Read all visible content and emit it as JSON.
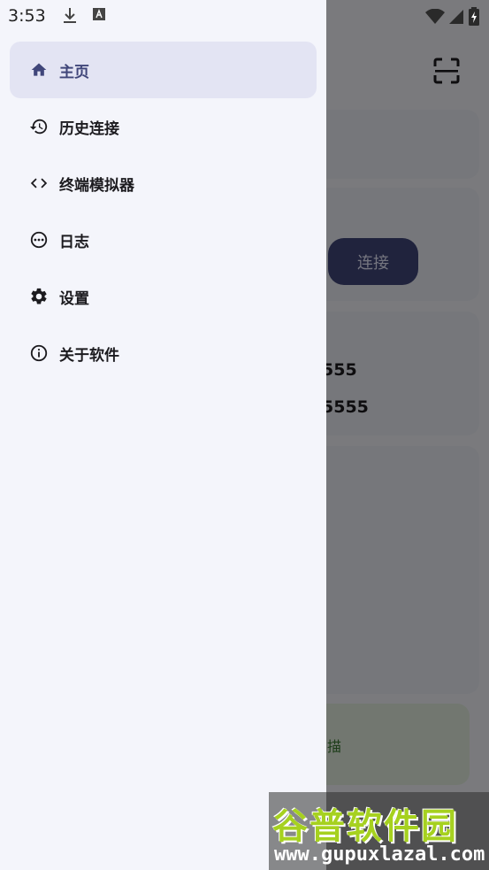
{
  "status_bar": {
    "time": "3:53",
    "left_icons": [
      "download-icon",
      "a-icon"
    ],
    "right_icons": [
      "wifi-icon",
      "signal-icon",
      "battery-charging-icon"
    ]
  },
  "drawer": {
    "items": [
      {
        "label": "主页",
        "icon": "home-icon",
        "active": true
      },
      {
        "label": "历史连接",
        "icon": "history-icon",
        "active": false
      },
      {
        "label": "终端模拟器",
        "icon": "code-icon",
        "active": false
      },
      {
        "label": "日志",
        "icon": "more-horiz-circle-icon",
        "active": false
      },
      {
        "label": "设置",
        "icon": "gear-icon",
        "active": false
      },
      {
        "label": "关于软件",
        "icon": "info-icon",
        "active": false
      }
    ]
  },
  "background": {
    "connect_button": "连接",
    "address_line_1": "555",
    "address_line_2": "5555",
    "scan_hint": "描"
  },
  "watermark": {
    "title": "谷普软件园",
    "url": "www.gupuxlazal.com"
  },
  "colors": {
    "accent": "#40467a",
    "active_bg": "#e3e4f3",
    "drawer_bg": "#f4f5fb",
    "scrim": "rgba(0,0,0,0.5)"
  }
}
